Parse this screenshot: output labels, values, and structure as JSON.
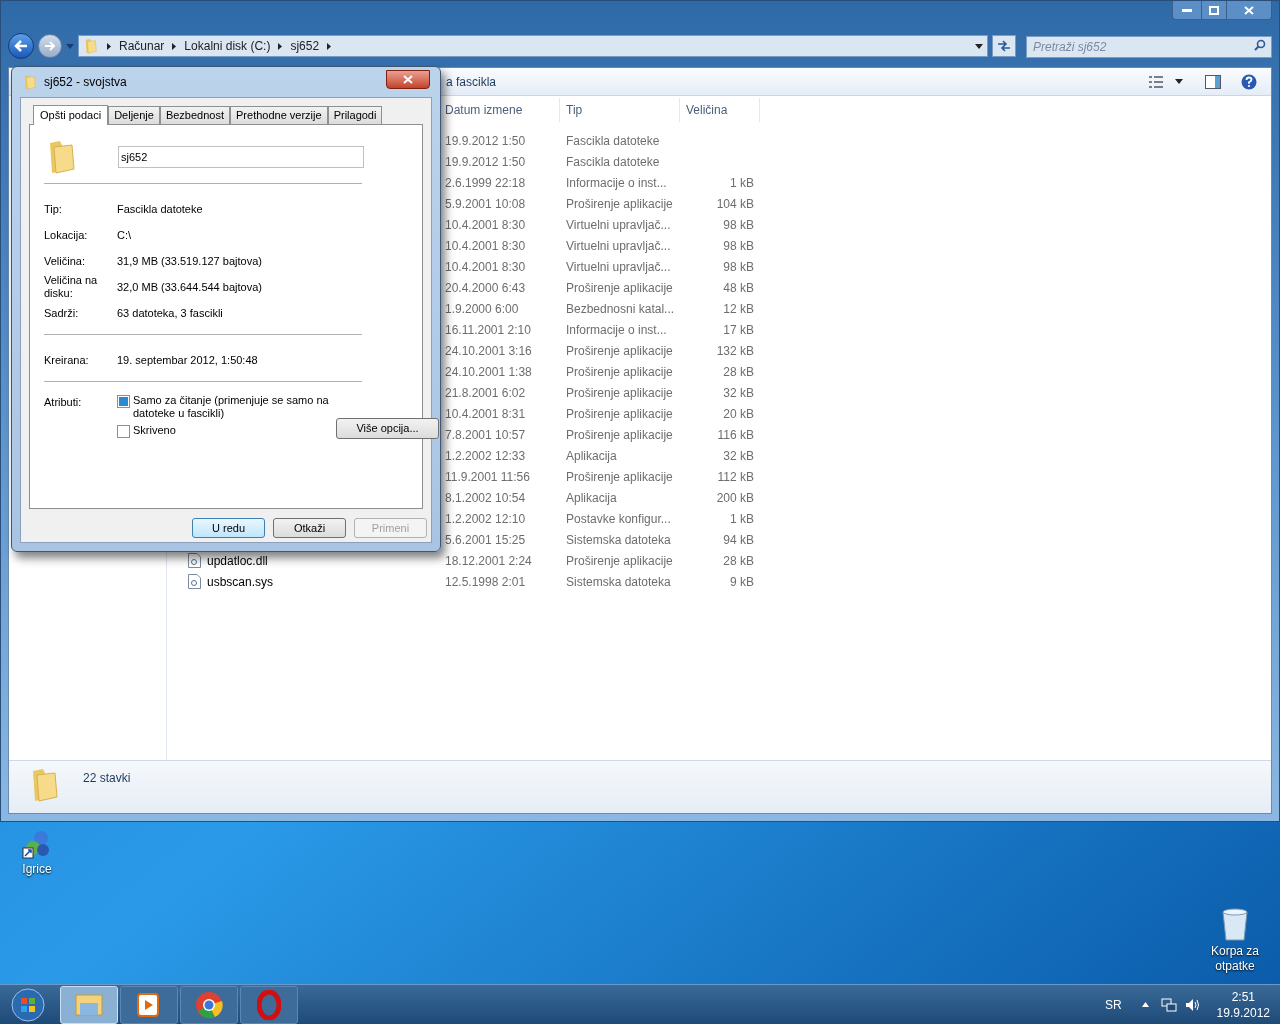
{
  "explorer": {
    "crumbs": [
      "Računar",
      "Lokalni disk (C:)",
      "sj652"
    ],
    "search": {
      "placeholder": "Pretraži sj652"
    },
    "toolbar_text": "a fascikla",
    "columns": [
      "Datum izmene",
      "Tip",
      "Veličina"
    ],
    "rows": [
      {
        "date": "19.9.2012 1:50",
        "type": "Fascikla datoteke",
        "size": ""
      },
      {
        "date": "19.9.2012 1:50",
        "type": "Fascikla datoteke",
        "size": ""
      },
      {
        "date": "2.6.1999 22:18",
        "type": "Informacije o inst...",
        "size": "1 kB"
      },
      {
        "date": "5.9.2001 10:08",
        "type": "Proširenje aplikacije",
        "size": "104 kB"
      },
      {
        "date": "10.4.2001 8:30",
        "type": "Virtuelni upravljač...",
        "size": "98 kB"
      },
      {
        "date": "10.4.2001 8:30",
        "type": "Virtuelni upravljač...",
        "size": "98 kB"
      },
      {
        "date": "10.4.2001 8:30",
        "type": "Virtuelni upravljač...",
        "size": "98 kB"
      },
      {
        "date": "20.4.2000 6:43",
        "type": "Proširenje aplikacije",
        "size": "48 kB"
      },
      {
        "date": "1.9.2000 6:00",
        "type": "Bezbednosni katal...",
        "size": "12 kB"
      },
      {
        "date": "16.11.2001 2:10",
        "type": "Informacije o inst...",
        "size": "17 kB"
      },
      {
        "date": "24.10.2001 3:16",
        "type": "Proširenje aplikacije",
        "size": "132 kB"
      },
      {
        "date": "24.10.2001 1:38",
        "type": "Proširenje aplikacije",
        "size": "28 kB"
      },
      {
        "date": "21.8.2001 6:02",
        "type": "Proširenje aplikacije",
        "size": "32 kB"
      },
      {
        "date": "10.4.2001 8:31",
        "type": "Proširenje aplikacije",
        "size": "20 kB"
      },
      {
        "date": "7.8.2001 10:57",
        "type": "Proširenje aplikacije",
        "size": "116 kB"
      },
      {
        "date": "1.2.2002 12:33",
        "type": "Aplikacija",
        "size": "32 kB"
      },
      {
        "date": "11.9.2001 11:56",
        "type": "Proširenje aplikacije",
        "size": "112 kB"
      },
      {
        "date": "8.1.2002 10:54",
        "type": "Aplikacija",
        "size": "200 kB"
      },
      {
        "date": "1.2.2002 12:10",
        "type": "Postavke konfigur...",
        "size": "1 kB"
      },
      {
        "date": "5.6.2001 15:25",
        "type": "Sistemska datoteka",
        "size": "94 kB"
      },
      {
        "name": "updatloc.dll",
        "date": "18.12.2001 2:24",
        "type": "Proširenje aplikacije",
        "size": "28 kB"
      },
      {
        "name": "usbscan.sys",
        "date": "12.5.1998 2:01",
        "type": "Sistemska datoteka",
        "size": "9 kB"
      }
    ],
    "status": "22 stavki"
  },
  "dialog": {
    "title": "sj652 - svojstva",
    "tabs": [
      {
        "label": "Opšti podaci",
        "selected": true
      },
      {
        "label": "Deljenje",
        "selected": false
      },
      {
        "label": "Bezbednost",
        "selected": false
      },
      {
        "label": "Prethodne verzije",
        "selected": false
      },
      {
        "label": "Prilagodi",
        "selected": false
      }
    ],
    "name_value": "sj652",
    "sections": [
      [
        {
          "label": "Tip:",
          "value": "Fascikla datoteke"
        },
        {
          "label": "Lokacija:",
          "value": "C:\\"
        },
        {
          "label": "Veličina:",
          "value": "31,9 MB (33.519.127 bajtova)"
        },
        {
          "label": "Veličina na disku:",
          "value": "32,0 MB (33.644.544 bajtova)"
        },
        {
          "label": "Sadrži:",
          "value": "63 datoteka, 3 fascikli"
        }
      ],
      [
        {
          "label": "Kreirana:",
          "value": "19. septembar 2012, 1:50:48"
        }
      ]
    ],
    "attributes_label": "Atributi:",
    "attributes": [
      {
        "label": "Samo za čitanje (primenjuje se samo na datoteke u fascikli)",
        "checked": false,
        "indeterminate": true
      },
      {
        "label": "Skriveno",
        "checked": false,
        "indeterminate": false
      }
    ],
    "advanced_button": "Više opcija...",
    "buttons": [
      {
        "label": "U redu",
        "default": true,
        "disabled": false
      },
      {
        "label": "Otkaži",
        "default": false,
        "disabled": false
      },
      {
        "label": "Primeni",
        "default": false,
        "disabled": true
      }
    ]
  },
  "desktop_icons": [
    {
      "kind": "shortcut",
      "label": "Igrice"
    },
    {
      "kind": "recycle-bin",
      "label": "Korpa za otpatke"
    }
  ],
  "taskbar": {
    "pinned": [
      {
        "kind": "explorer",
        "selected": true
      },
      {
        "kind": "media",
        "selected": false
      },
      {
        "kind": "chrome",
        "selected": false
      },
      {
        "kind": "opera",
        "selected": false
      }
    ],
    "language": "SR",
    "time": "2:51",
    "date": "19.9.2012"
  }
}
